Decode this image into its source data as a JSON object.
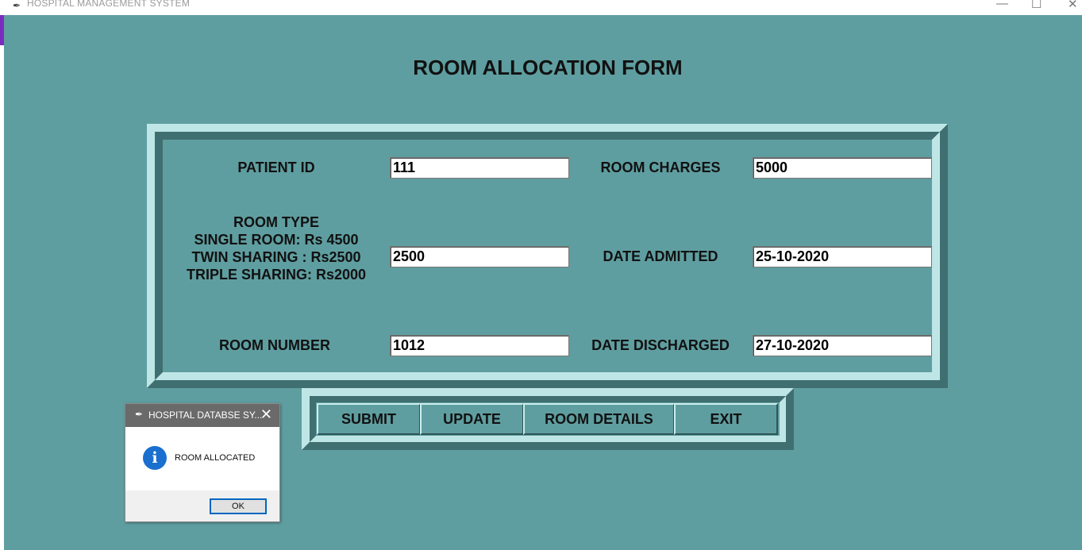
{
  "window": {
    "title": "HOSPITAL MANAGEMENT SYSTEM",
    "minimize": "—",
    "maximize": "☐",
    "close": "✕"
  },
  "form": {
    "title": "ROOM ALLOCATION FORM",
    "patient_id_label": "PATIENT ID",
    "patient_id_value": "111",
    "room_charges_label": "ROOM CHARGES",
    "room_charges_value": "5000",
    "room_type_label": "ROOM TYPE",
    "room_type_line1": "SINGLE ROOM: Rs 4500",
    "room_type_line2": "TWIN SHARING : Rs2500",
    "room_type_line3": "TRIPLE SHARING: Rs2000",
    "room_type_value": "2500",
    "date_admitted_label": "DATE ADMITTED",
    "date_admitted_value": "25-10-2020",
    "room_number_label": "ROOM NUMBER",
    "room_number_value": "1012",
    "date_discharged_label": "DATE DISCHARGED",
    "date_discharged_value": "27-10-2020"
  },
  "buttons": {
    "submit": "SUBMIT",
    "update": "UPDATE",
    "room_details": "ROOM DETAILS",
    "exit": "EXIT"
  },
  "dialog": {
    "title": "HOSPITAL DATABSE SY...",
    "message": "ROOM ALLOCATED",
    "ok": "OK",
    "close": "✕",
    "icon": "info-icon"
  },
  "colors": {
    "background": "#5f9ea0",
    "frame_light": "#bfe6e6",
    "frame_dark": "#3f6f70"
  }
}
